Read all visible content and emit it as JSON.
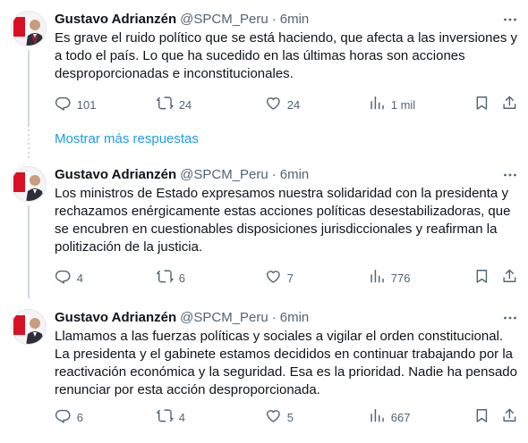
{
  "tweets": [
    {
      "name": "Gustavo Adrianzén",
      "handle": "@SPCM_Peru",
      "dot": "·",
      "time": "6min",
      "text": "Es grave el ruido político que se está haciendo, que afecta  a las inversiones y a todo el país. Lo que ha sucedido en las últimas horas son acciones desproporcionadas e inconstitucionales.",
      "replies": "101",
      "retweets": "24",
      "likes": "24",
      "views": "1 mil"
    },
    {
      "name": "Gustavo Adrianzén",
      "handle": "@SPCM_Peru",
      "dot": "·",
      "time": "6min",
      "text": "Los ministros de Estado expresamos nuestra solidaridad con la presidenta y rechazamos enérgicamente estas acciones políticas desestabilizadoras, que se encubren en cuestionables disposiciones jurisdiccionales y reafirman la politización de la justicia.",
      "replies": "4",
      "retweets": "6",
      "likes": "7",
      "views": "776"
    },
    {
      "name": "Gustavo Adrianzén",
      "handle": "@SPCM_Peru",
      "dot": "·",
      "time": "6min",
      "text": "Llamamos a las fuerzas políticas y sociales a vigilar el orden constitucional. La presidenta y el gabinete estamos decididos en continuar trabajando por la reactivación económica y la seguridad. Esa es la prioridad. Nadie ha pensado renunciar por esta acción desproporcionada.",
      "replies": "6",
      "retweets": "4",
      "likes": "5",
      "views": "667"
    }
  ],
  "show_more_label": "Mostrar más respuestas",
  "colors": {
    "text": "#0f1419",
    "secondary": "#536471",
    "link": "#1d9bf0",
    "thread": "#cfd9de"
  },
  "icons": [
    "more-icon",
    "reply-icon",
    "retweet-icon",
    "like-icon",
    "views-icon",
    "bookmark-icon",
    "share-icon"
  ]
}
